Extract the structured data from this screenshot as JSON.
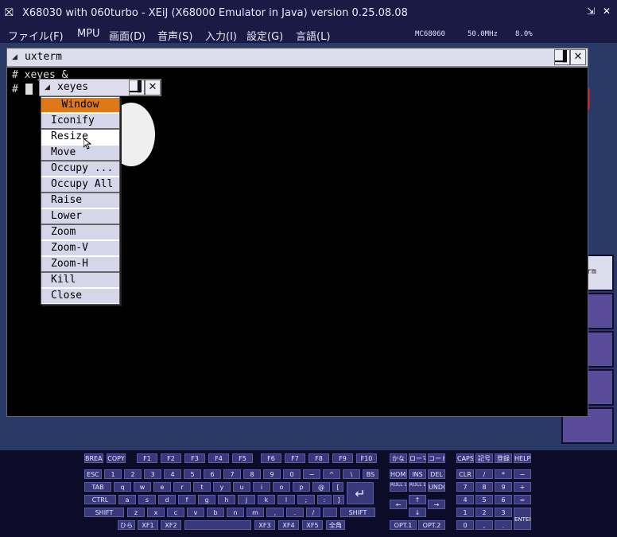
{
  "window": {
    "title": "X68030 with 060turbo - XEiJ (X68000 Emulator in Java) version 0.25.08.08",
    "app_icon": "x68000-logo-icon",
    "minimize_icon": "minimize-icon",
    "close_icon": "close-icon"
  },
  "menubar": {
    "items": [
      "ファイル(F)",
      "MPU",
      "画面(D)",
      "音声(S)",
      "入力(I)",
      "設定(G)",
      "言語(L)"
    ],
    "status_cpu": "MC68060",
    "status_clock": "50.0MHz",
    "status_load": "8.0%"
  },
  "uxterm": {
    "title": "uxterm",
    "line1": "# xeyes &",
    "line2": "#",
    "close_glyph": "✕"
  },
  "xeyes": {
    "title": "xeyes",
    "close_glyph": "✕"
  },
  "context_menu": {
    "header": "Window",
    "items": [
      "Iconify",
      "Resize",
      "Move",
      "Occupy ...",
      "Occupy All",
      "Raise",
      "Lower",
      "Zoom",
      "Zoom-V",
      "Zoom-H",
      "Kill",
      "Close"
    ]
  },
  "right_panel": {
    "partial_label": "rm"
  },
  "keyboard": {
    "row1": [
      "BREAK",
      "COPY",
      "F1",
      "F2",
      "F3",
      "F4",
      "F5",
      "F6",
      "F7",
      "F8",
      "F9",
      "F10",
      "かな",
      "ローマ",
      "コード",
      "CAPS",
      "記号",
      "登録",
      "HELP"
    ],
    "row2": [
      "ESC",
      "1",
      "2",
      "3",
      "4",
      "5",
      "6",
      "7",
      "8",
      "9",
      "0",
      "−",
      "^",
      "\\",
      "BS",
      "HOME",
      "INS",
      "DEL",
      "CLR",
      "/",
      "*",
      "−"
    ],
    "row3": [
      "TAB",
      "q",
      "w",
      "e",
      "r",
      "t",
      "y",
      "u",
      "i",
      "o",
      "p",
      "@",
      "[",
      "ROLL UP",
      "ROLL DOWN",
      "UNDO",
      "7",
      "8",
      "9",
      "+"
    ],
    "row4": [
      "CTRL",
      "a",
      "s",
      "d",
      "f",
      "g",
      "h",
      "j",
      "k",
      "l",
      ";",
      ":",
      "]",
      "←",
      "↑",
      "→",
      "4",
      "5",
      "6",
      "="
    ],
    "row5": [
      "SHIFT",
      "z",
      "x",
      "c",
      "v",
      "b",
      "n",
      "m",
      ",",
      ".",
      "/",
      "",
      "SHIFT",
      "↓",
      "1",
      "2",
      "3",
      "ENTER"
    ],
    "row6": [
      "ひら",
      "XF1",
      "XF2",
      "",
      "XF3",
      "XF4",
      "XF5",
      "全角",
      "OPT.1",
      "OPT.2",
      "0",
      ",",
      "."
    ],
    "return_glyph": "↵"
  }
}
